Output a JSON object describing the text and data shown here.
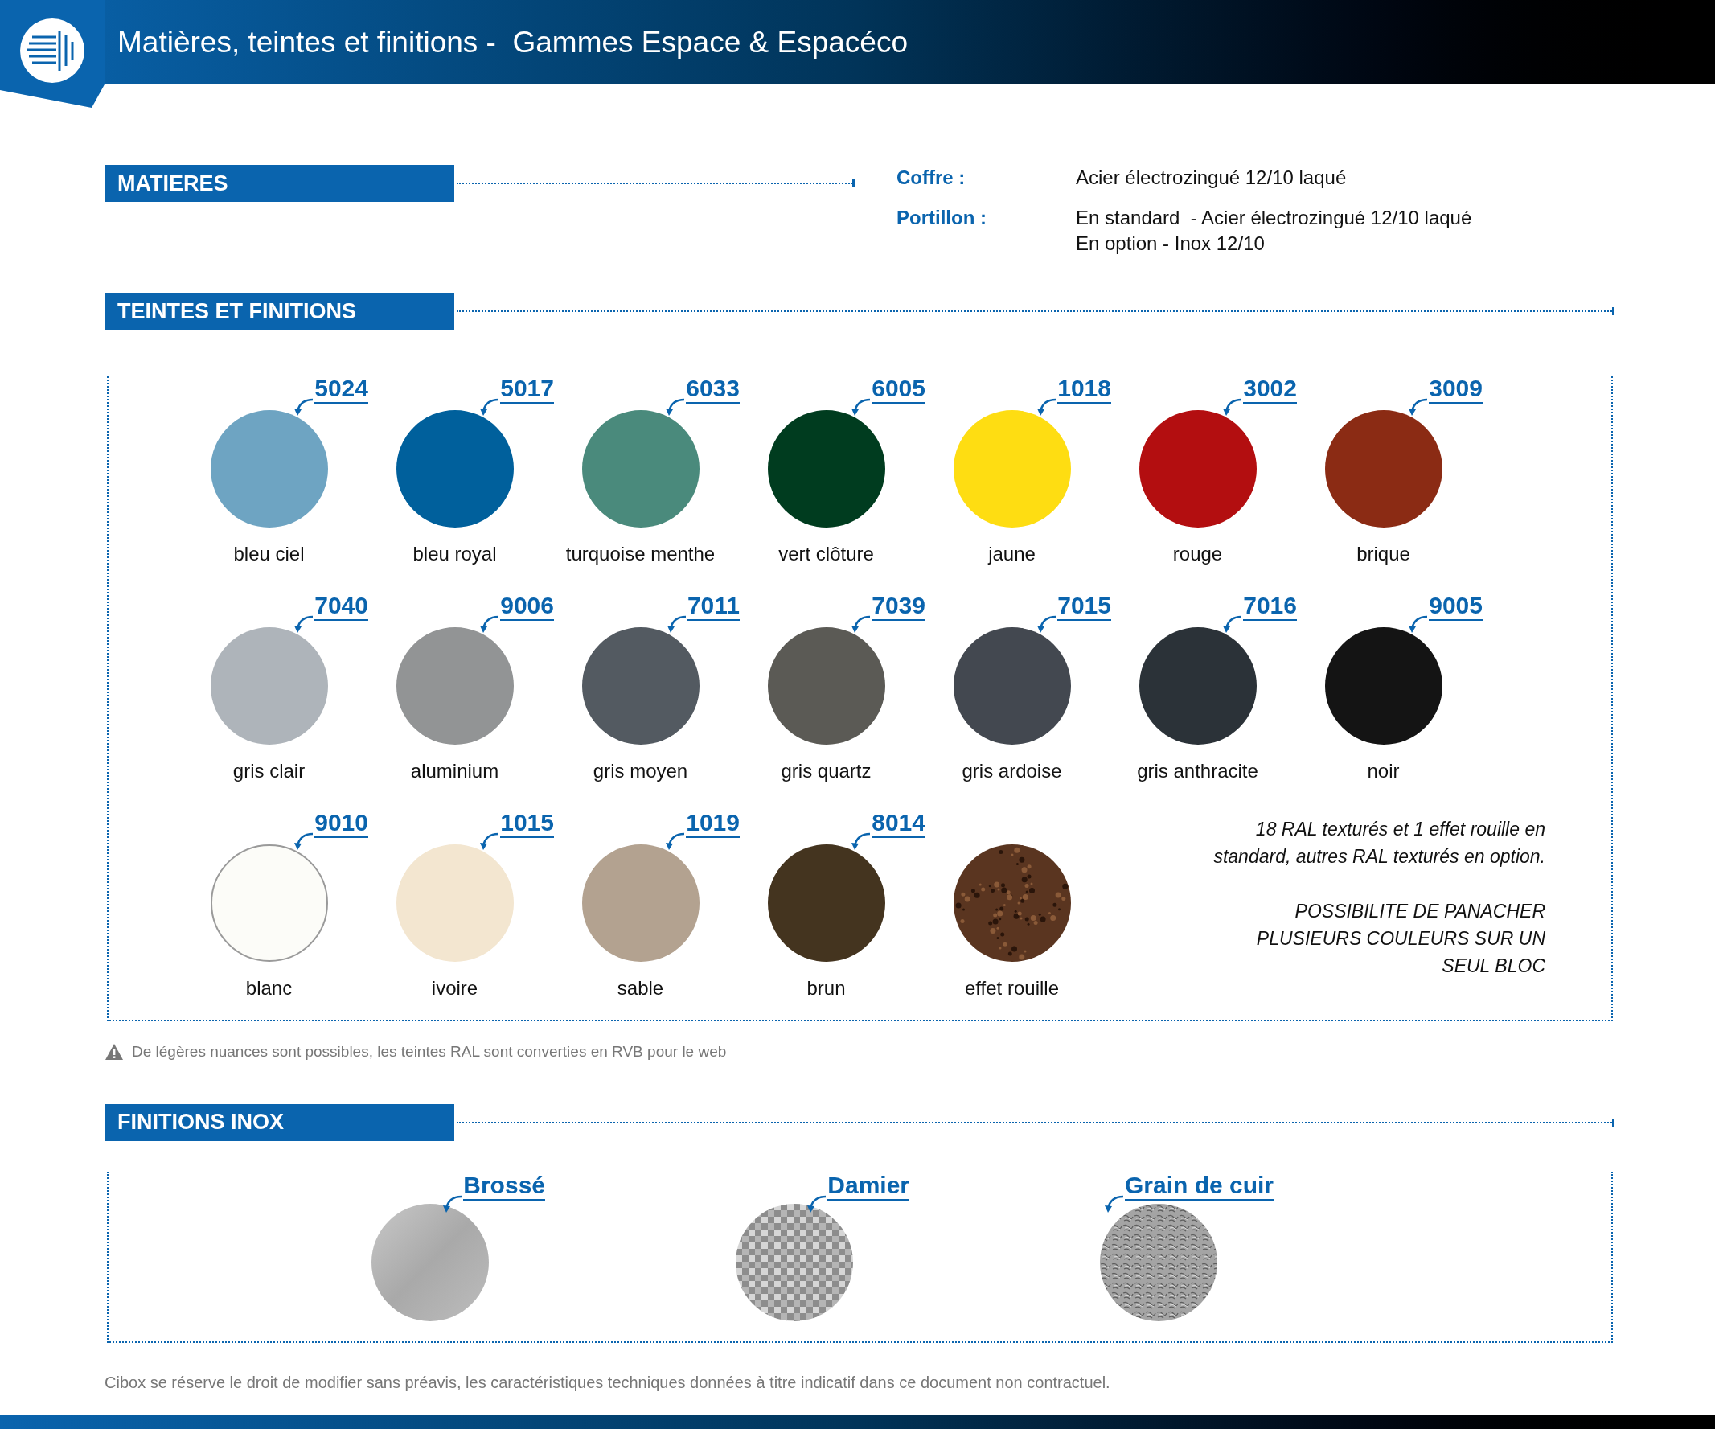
{
  "header": {
    "title": "Matières, teintes et finitions -  Gammes Espace & Espacéco"
  },
  "matieres": {
    "title": "MATIERES",
    "rows": [
      {
        "label": "Coffre :",
        "lines": [
          "Acier électrozingué 12/10 laqué"
        ]
      },
      {
        "label": "Portillon :",
        "lines": [
          "En standard  - Acier électrozingué 12/10 laqué",
          "En option - Inox 12/10"
        ]
      }
    ]
  },
  "teintes": {
    "title": "TEINTES ET FINITIONS",
    "swatches": [
      {
        "code": "5024",
        "name": "bleu ciel",
        "color": "#6ea4c2",
        "kind": "solid"
      },
      {
        "code": "5017",
        "name": "bleu royal",
        "color": "#00609c",
        "kind": "solid"
      },
      {
        "code": "6033",
        "name": "turquoise menthe",
        "color": "#4a8a7c",
        "kind": "solid"
      },
      {
        "code": "6005",
        "name": "vert clôture",
        "color": "#003c1f",
        "kind": "solid"
      },
      {
        "code": "1018",
        "name": "jaune",
        "color": "#fedd12",
        "kind": "solid"
      },
      {
        "code": "3002",
        "name": "rouge",
        "color": "#b30e10",
        "kind": "solid"
      },
      {
        "code": "3009",
        "name": "brique",
        "color": "#8b2b14",
        "kind": "solid"
      },
      {
        "code": "7040",
        "name": "gris clair",
        "color": "#aeb4ba",
        "kind": "solid"
      },
      {
        "code": "9006",
        "name": "aluminium",
        "color": "#929495",
        "kind": "solid"
      },
      {
        "code": "7011",
        "name": "gris moyen",
        "color": "#535a61",
        "kind": "solid"
      },
      {
        "code": "7039",
        "name": "gris quartz",
        "color": "#5b5a55",
        "kind": "solid"
      },
      {
        "code": "7015",
        "name": "gris ardoise",
        "color": "#434850",
        "kind": "solid"
      },
      {
        "code": "7016",
        "name": "gris anthracite",
        "color": "#2b3238",
        "kind": "solid"
      },
      {
        "code": "9005",
        "name": "noir",
        "color": "#141414",
        "kind": "solid"
      },
      {
        "code": "9010",
        "name": "blanc",
        "color": "#fcfcf8",
        "kind": "outlined"
      },
      {
        "code": "1015",
        "name": "ivoire",
        "color": "#f3e6d0",
        "kind": "solid"
      },
      {
        "code": "1019",
        "name": "sable",
        "color": "#b3a290",
        "kind": "solid"
      },
      {
        "code": "8014",
        "name": "brun",
        "color": "#44341f",
        "kind": "solid"
      },
      {
        "name": "effet rouille",
        "color": "#5a3520",
        "kind": "texture"
      }
    ],
    "note": [
      "18 RAL texturés et 1 effet rouille en standard, autres RAL texturés en option.",
      "POSSIBILITE DE PANACHER PLUSIEURS COULEURS SUR UN SEUL BLOC"
    ]
  },
  "warning": "De légères nuances sont possibles, les teintes RAL sont converties en RVB pour le web",
  "inox": {
    "title": "FINITIONS INOX",
    "finishes": [
      {
        "name": "Brossé",
        "kind": "brushed"
      },
      {
        "name": "Damier",
        "kind": "checker"
      },
      {
        "name": "Grain de cuir",
        "kind": "grain"
      }
    ]
  },
  "footer": "Cibox se réserve le droit de modifier sans préavis, les caractéristiques techniques données à titre indicatif dans ce document non contractuel."
}
